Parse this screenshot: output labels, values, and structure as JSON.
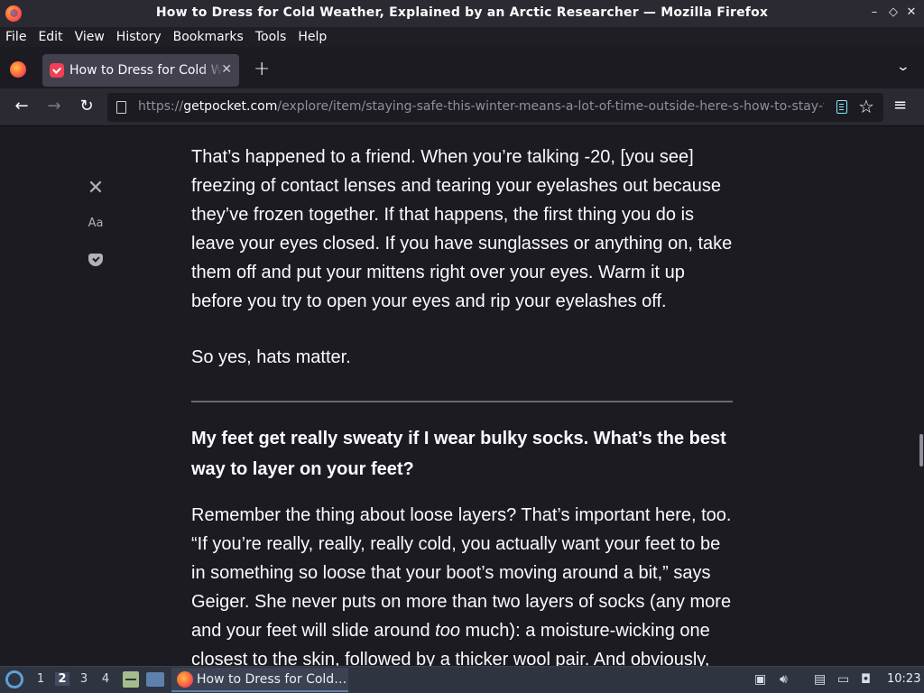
{
  "window": {
    "title": "How to Dress for Cold Weather, Explained by an Arctic Researcher — Mozilla Firefox",
    "controls": {
      "minimize": "–",
      "maximize": "◇",
      "close": "✕"
    }
  },
  "menubar": {
    "items": [
      {
        "label": "File"
      },
      {
        "label": "Edit"
      },
      {
        "label": "View"
      },
      {
        "label": "History"
      },
      {
        "label": "Bookmarks"
      },
      {
        "label": "Tools"
      },
      {
        "label": "Help"
      }
    ]
  },
  "tabs": {
    "active": {
      "title": "How to Dress for Cold Weather, Explained by an Arctic Researcher",
      "close": "✕"
    },
    "new_tab": "+",
    "list_all": "⌄"
  },
  "navbar": {
    "back": "←",
    "forward": "→",
    "reload": "↻",
    "url_prefix": "https://",
    "url_domain": "getpocket.com",
    "url_path": "/explore/item/staying-safe-this-winter-means-a-lot-of-time-outside-here-s-how-to-stay-warm",
    "bookmark": "☆",
    "menu": "≡"
  },
  "reader": {
    "close": "✕",
    "type_controls": "Aa",
    "accent_color": "#80ebff"
  },
  "article": {
    "p1": "That’s happened to a friend. When you’re talking -20, [you see] freezing of contact lenses and tearing your eyelashes out because they’ve frozen together. If that happens, the first thing you do is leave your eyes closed. If you have sunglasses or anything on, take them off and put your mittens right over your eyes. Warm it up before you try to open your eyes and rip your eyelashes off.",
    "p2": "So yes, hats matter.",
    "heading": "My feet get really sweaty if I wear bulky socks. What’s the best way to layer on your feet?",
    "p3_before": "Remember the thing about loose layers? That’s important here, too. “If you’re really, really, really cold, you actually want your feet to be in something so loose that your boot’s moving around a bit,” says Geiger. She never puts on more than two layers of socks (any more and your feet will slide around ",
    "p3_em": "too",
    "p3_after": " much): a moisture-wicking one closest to the skin, followed by a thicker wool pair. And obviously, make sure your boots are waterproof."
  },
  "taskbar": {
    "workspaces": [
      "1",
      "2",
      "3",
      "4"
    ],
    "active_workspace": "2",
    "task_label": "How to Dress for Cold…",
    "clock": "10:23"
  }
}
